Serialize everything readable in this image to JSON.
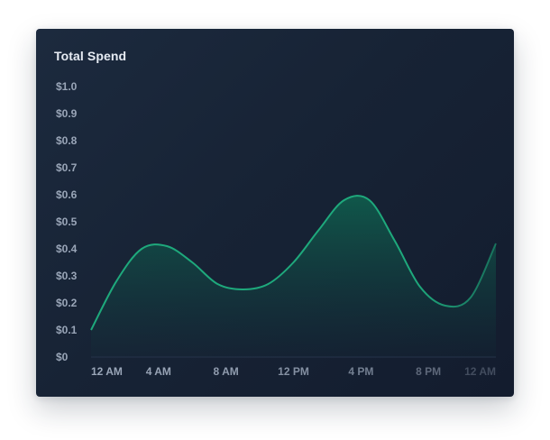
{
  "card": {
    "title": "Total Spend"
  },
  "chart_data": {
    "type": "area",
    "title": "Total Spend",
    "xlabel": "",
    "ylabel": "",
    "x_ticks": [
      "12 AM",
      "4 AM",
      "8 AM",
      "12 PM",
      "4 PM",
      "8 PM",
      "12 AM"
    ],
    "y_ticks": [
      "$0",
      "$0.1",
      "$0.2",
      "$0.3",
      "$0.4",
      "$0.5",
      "$0.6",
      "$0.7",
      "$0.8",
      "$0.9",
      "$1.0"
    ],
    "ylim": [
      0,
      1.0
    ],
    "xlim": [
      0,
      24
    ],
    "grid": false,
    "series": [
      {
        "x": [
          0,
          1.5,
          3,
          4.5,
          6,
          7.5,
          9,
          10.5,
          12,
          13.5,
          15,
          16.5,
          18,
          19.5,
          21,
          22.5,
          24
        ],
        "values": [
          0.1,
          0.28,
          0.4,
          0.41,
          0.35,
          0.27,
          0.25,
          0.27,
          0.35,
          0.47,
          0.58,
          0.58,
          0.43,
          0.26,
          0.19,
          0.22,
          0.42
        ],
        "color": "#1ea97c"
      }
    ]
  },
  "colors": {
    "background": "#172335",
    "line": "#1ea97c",
    "axis_text": "#9aa6b8",
    "axis_line": "#26334a"
  }
}
